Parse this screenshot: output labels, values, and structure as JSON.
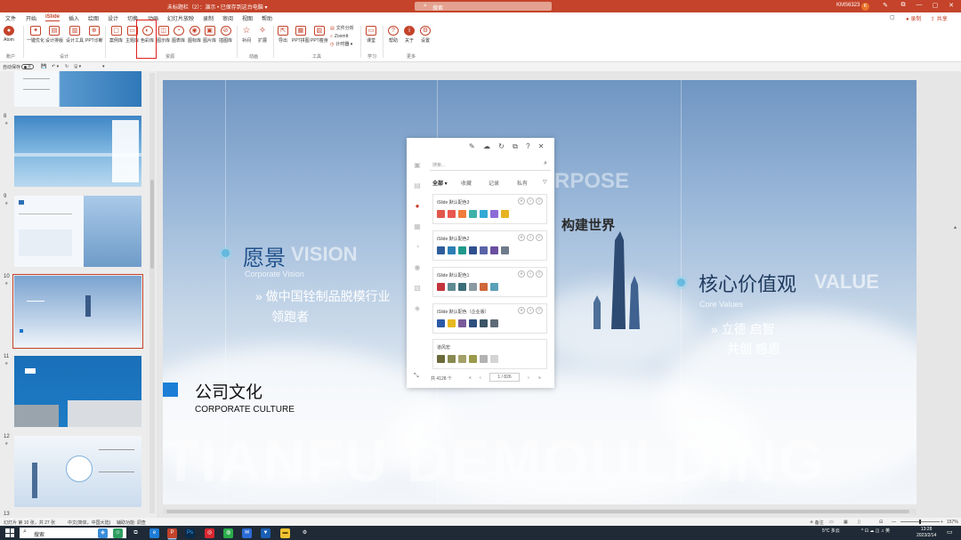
{
  "titlebar": {
    "doc_title": "未标题栏（2）：演示 • 已保存到这台电脑 ▾",
    "search_placeholder": "搜索",
    "user": "KMS6323",
    "avatar_letter": "K",
    "controls": [
      "✎",
      "⧉",
      "—",
      "▢",
      "✕"
    ]
  },
  "menu": {
    "tabs": [
      "文件",
      "开始",
      "iSlide",
      "插入",
      "绘图",
      "设计",
      "切换",
      "动画",
      "幻灯片放映",
      "录制",
      "审阅",
      "视图",
      "帮助"
    ],
    "active_tab": "iSlide",
    "comment_label": "▢",
    "record_label": "● 录制",
    "share_label": "⇪ 共享"
  },
  "ribbon": {
    "atom_label": "Atom",
    "account_group": "账户",
    "design_items": [
      "一键优化",
      "设计排版",
      "设计工具",
      "PPT诊断"
    ],
    "design_group": "设计",
    "resource_items": [
      "案例库",
      "主题库",
      "色彩库",
      "图示库",
      "图表库",
      "图标库",
      "图片库",
      "插图库"
    ],
    "resource_group": "资源",
    "anim_items": [
      "补间",
      "扩展"
    ],
    "anim_group": "动画",
    "tool_items": [
      "导出",
      "PPT拼图",
      "PPT瘦身"
    ],
    "tool_small": [
      "文件分析",
      "ZoomIt",
      "计时器 ▾"
    ],
    "tool_group": "工具",
    "learn_items": [
      "课堂"
    ],
    "learn_group": "学习",
    "more_items": [
      "帮助",
      "关于",
      "设置"
    ],
    "more_group": "更多"
  },
  "qat": {
    "autosave": "自动保存",
    "toggle_state": "关",
    "items": [
      "💾",
      "↶ ▾",
      "↻",
      "🖫 ▾",
      "▾"
    ]
  },
  "slides": [
    {
      "num": "8",
      "star": "★"
    },
    {
      "num": "9",
      "star": "★"
    },
    {
      "num": "10",
      "star": "★"
    },
    {
      "num": "11",
      "star": "★"
    },
    {
      "num": "12",
      "star": "★"
    },
    {
      "num": "13",
      "star": ""
    }
  ],
  "slide": {
    "vision_cn": "愿景",
    "vision_en": "VISION",
    "vision_sub": "Corporate Vision",
    "vision_body1": "» 做中国铨制品脱模行业",
    "vision_body2": "领跑者",
    "world_cn": "构建世界",
    "purpose_en": "RPOSE",
    "value_cn": "核心价值观",
    "value_en": "VALUE",
    "value_sub": "Core Values",
    "value_body1": "» 立德 启智",
    "value_body2": "共创 感恩",
    "culture_cn": "公司文化",
    "culture_en": "CORPORATE CULTURE",
    "big_bg": "TIANFU DEMOULDING"
  },
  "palette": {
    "top_icons": [
      "✎",
      "☁",
      "↻",
      "⧉",
      "?",
      "✕"
    ],
    "side_icons": [
      "▣",
      "▤",
      "●",
      "▦",
      "◔",
      "◉",
      "▧",
      "◈"
    ],
    "search_placeholder": "搜索...",
    "tabs": [
      "全部 ▾",
      "收藏",
      "记录",
      "私有"
    ],
    "filter_icon": "▽",
    "schemes": [
      {
        "name": "iSlide 默认配色3",
        "colors": [
          "#e2574c",
          "#e8584f",
          "#f07c3c",
          "#3db2a8",
          "#33a9d6",
          "#8d6bd8",
          "#e6b422"
        ]
      },
      {
        "name": "iSlide 默认配色2",
        "colors": [
          "#2e5d9b",
          "#2b7fb5",
          "#1f9a8a",
          "#2f4f8f",
          "#5b63a8",
          "#6a4ea0",
          "#6e7b8a"
        ]
      },
      {
        "name": "iSlide 默认配色1",
        "colors": [
          "#c3343d",
          "#5e8c92",
          "#3a6e79",
          "#8a9aa3",
          "#d0683a",
          "#5aa0b9"
        ]
      },
      {
        "name": "iSlide 默认配色（企业版）",
        "colors": [
          "#2b5aa8",
          "#e8b822",
          "#7a5a9a",
          "#2f4f7f",
          "#3d5566",
          "#5f6b78"
        ]
      },
      {
        "name": "道风宏",
        "colors": [
          "#6b6a3a",
          "#888a52",
          "#a3a16a",
          "#9a9a4a",
          "#b2b2b2",
          "#d4d4d4"
        ]
      }
    ],
    "total": "共 4128 个",
    "first": "«",
    "prev": "‹",
    "page": "1 / 826",
    "next": "›",
    "last": "»",
    "collapse_icon": "⤡"
  },
  "status": {
    "slide_info": "幻灯片 第 10 张，共 27 张",
    "lang": "中文(简体，中国大陆)",
    "accessibility": "辅助功能: 调查",
    "notes": "≙ 备注",
    "zoom": "157%",
    "zoom_minus": "—",
    "zoom_plus": "+",
    "fit": "⊡"
  },
  "taskbar": {
    "search": "搜索",
    "weather": "5°C 多云",
    "tray": "^ ⊡ ☁ ◫ ♫ 英",
    "time": "13:28",
    "date": "2023/2/14"
  }
}
